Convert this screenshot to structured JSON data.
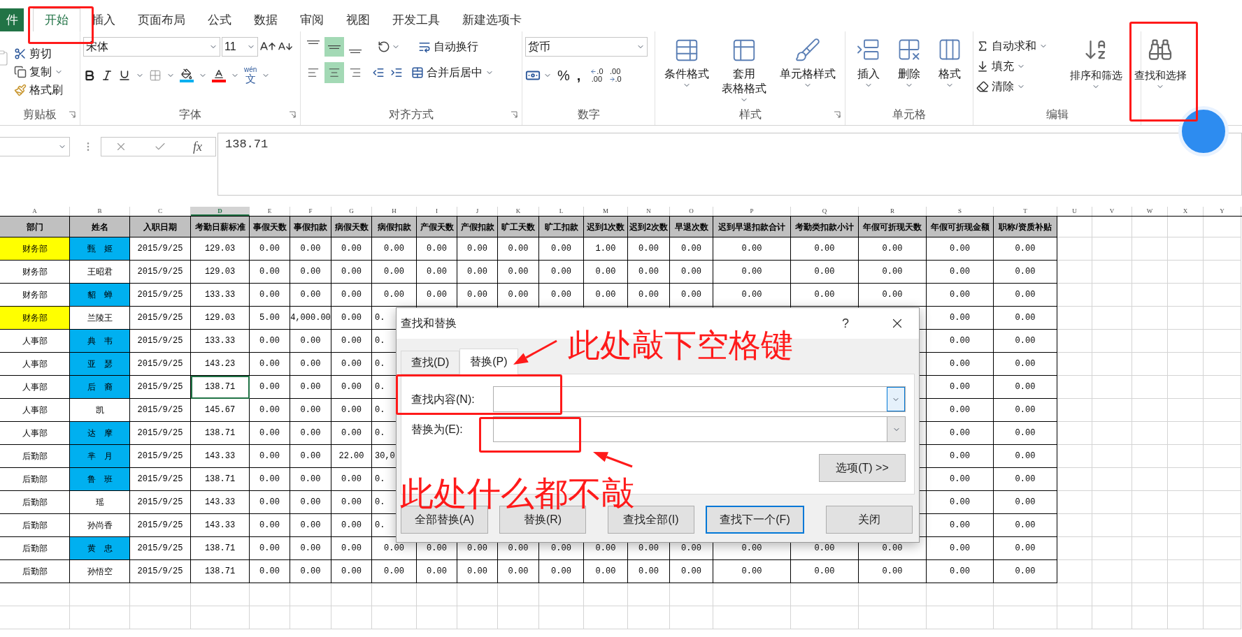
{
  "ribbon_tabs": [
    {
      "label": "件",
      "kind": "file",
      "selected": false
    },
    {
      "label": "开始",
      "kind": "tab",
      "selected": true
    },
    {
      "label": "插入",
      "kind": "tab",
      "selected": false
    },
    {
      "label": "页面布局",
      "kind": "tab",
      "selected": false
    },
    {
      "label": "公式",
      "kind": "tab",
      "selected": false
    },
    {
      "label": "数据",
      "kind": "tab",
      "selected": false
    },
    {
      "label": "审阅",
      "kind": "tab",
      "selected": false
    },
    {
      "label": "视图",
      "kind": "tab",
      "selected": false
    },
    {
      "label": "开发工具",
      "kind": "tab",
      "selected": false
    },
    {
      "label": "新建选项卡",
      "kind": "tab",
      "selected": false
    }
  ],
  "ribbon": {
    "clipboard": {
      "label": "剪贴板",
      "cut": "剪切",
      "copy": "复制",
      "painter": "格式刷"
    },
    "font": {
      "label": "字体",
      "font_name": "宋体",
      "font_size": "11",
      "phonetic_top": "wén",
      "phonetic_bottom": "文"
    },
    "alignment": {
      "label": "对齐方式",
      "vertical": [
        {
          "selected": false
        },
        {
          "selected": true
        },
        {
          "selected": false
        }
      ],
      "horizontal": [
        {
          "selected": false
        },
        {
          "selected": true
        },
        {
          "selected": false
        }
      ],
      "wrap": "自动换行",
      "merge": "合并后居中"
    },
    "number": {
      "label": "数字",
      "format": "货币",
      "percent": "%",
      "comma": ",",
      "increase_decimal": [
        ".0",
        ".00"
      ],
      "decrease_decimal": [
        ".00",
        ".0"
      ]
    },
    "styles": {
      "label": "样式",
      "buttons": [
        {
          "lines": [
            "条件格式"
          ]
        },
        {
          "lines": [
            "套用",
            "表格格式"
          ]
        },
        {
          "lines": [
            "单元格样式"
          ]
        }
      ]
    },
    "cells": {
      "label": "单元格",
      "buttons": [
        "插入",
        "删除",
        "格式"
      ]
    },
    "editing": {
      "label": "编辑",
      "small": [
        "自动求和",
        "填充",
        "清除"
      ],
      "large": [
        "排序和筛选",
        "查找和选择"
      ]
    }
  },
  "formula_bar": {
    "fx": "fx",
    "value": "138.71"
  },
  "table": {
    "column_letters": [
      {
        "label": "A",
        "selected": false
      },
      {
        "label": "B",
        "selected": false
      },
      {
        "label": "C",
        "selected": false
      },
      {
        "label": "D",
        "selected": true
      },
      {
        "label": "E",
        "selected": false
      },
      {
        "label": "F",
        "selected": false
      },
      {
        "label": "G",
        "selected": false
      },
      {
        "label": "H",
        "selected": false
      },
      {
        "label": "I",
        "selected": false
      },
      {
        "label": "J",
        "selected": false
      },
      {
        "label": "K",
        "selected": false
      },
      {
        "label": "L",
        "selected": false
      },
      {
        "label": "M",
        "selected": false
      },
      {
        "label": "N",
        "selected": false
      },
      {
        "label": "O",
        "selected": false
      },
      {
        "label": "P",
        "selected": false
      },
      {
        "label": "Q",
        "selected": false
      },
      {
        "label": "R",
        "selected": false
      },
      {
        "label": "S",
        "selected": false
      },
      {
        "label": "T",
        "selected": false
      },
      {
        "label": "U",
        "selected": false
      },
      {
        "label": "V",
        "selected": false
      },
      {
        "label": "W",
        "selected": false
      },
      {
        "label": "X",
        "selected": false
      },
      {
        "label": "Y",
        "selected": false
      }
    ],
    "headers": [
      "部门",
      "姓名",
      "入职日期",
      "考勤日薪标准",
      "事假天数",
      "事假扣款",
      "病假天数",
      "病假扣款",
      "产假天数",
      "产假扣款",
      "旷工天数",
      "旷工扣款",
      "迟到1次数",
      "迟到2次数",
      "早退次数",
      "迟到早退扣款合计",
      "考勤类扣款小计",
      "年假可折现天数",
      "年假可折现金额",
      "职称/资质补贴"
    ],
    "rows": [
      {
        "cells": [
          {
            "text": "财务部",
            "color": "#ffff00"
          },
          {
            "text": "甄　姬",
            "color": "#00b0f0"
          },
          "2015/9/25",
          "129.03",
          "0.00",
          "0.00",
          "0.00",
          "0.00",
          "0.00",
          "0.00",
          "0.00",
          "0.00",
          "1.00",
          "0.00",
          "0.00",
          "0.00",
          "0.00",
          "0.00",
          "0.00",
          "0.00"
        ],
        "active": false,
        "covered": false
      },
      {
        "cells": [
          "财务部",
          "王昭君",
          "2015/9/25",
          "129.03",
          "0.00",
          "0.00",
          "0.00",
          "0.00",
          "0.00",
          "0.00",
          "0.00",
          "0.00",
          "0.00",
          "0.00",
          "0.00",
          "0.00",
          "0.00",
          "0.00",
          "0.00",
          "0.00"
        ],
        "active": false,
        "covered": false
      },
      {
        "cells": [
          "财务部",
          {
            "text": "貂　蝉",
            "color": "#00b0f0"
          },
          "2015/9/25",
          "133.33",
          "0.00",
          "0.00",
          "0.00",
          "0.00",
          "0.00",
          "0.00",
          "0.00",
          "0.00",
          "0.00",
          "0.00",
          "0.00",
          "0.00",
          "0.00",
          "0.00",
          "0.00",
          "0.00"
        ],
        "active": false,
        "covered": false
      },
      {
        "cells": [
          {
            "text": "财务部",
            "color": "#ffff00"
          },
          "兰陵王",
          "2015/9/25",
          "129.03",
          "5.00",
          "4,000.00",
          "0.00",
          "0.",
          null,
          null,
          null,
          null,
          null,
          null,
          null,
          null,
          null,
          null,
          "0.00",
          "0.00"
        ],
        "active": false,
        "covered": true
      },
      {
        "cells": [
          "人事部",
          {
            "text": "典　韦",
            "color": "#00b0f0"
          },
          "2015/9/25",
          "133.33",
          "0.00",
          "0.00",
          "0.00",
          "0.",
          null,
          null,
          null,
          null,
          null,
          null,
          null,
          null,
          null,
          null,
          "0.00",
          "0.00"
        ],
        "active": false,
        "covered": true
      },
      {
        "cells": [
          "人事部",
          {
            "text": "亚　瑟",
            "color": "#00b0f0"
          },
          "2015/9/25",
          "143.23",
          "0.00",
          "0.00",
          "0.00",
          "0.",
          null,
          null,
          null,
          null,
          null,
          null,
          null,
          null,
          null,
          null,
          "0.00",
          "0.00"
        ],
        "active": false,
        "covered": true
      },
      {
        "cells": [
          "人事部",
          {
            "text": "后　裔",
            "color": "#00b0f0"
          },
          "2015/9/25",
          "138.71",
          "0.00",
          "0.00",
          "0.00",
          "0.",
          null,
          null,
          null,
          null,
          null,
          null,
          null,
          null,
          null,
          null,
          "0.00",
          "0.00"
        ],
        "active": true,
        "covered": true
      },
      {
        "cells": [
          "人事部",
          "凯",
          "2015/9/25",
          "145.67",
          "0.00",
          "0.00",
          "0.00",
          "0.",
          null,
          null,
          null,
          null,
          null,
          null,
          null,
          null,
          null,
          null,
          "0.00",
          "0.00"
        ],
        "active": false,
        "covered": true
      },
      {
        "cells": [
          "人事部",
          {
            "text": "达　摩",
            "color": "#00b0f0"
          },
          "2015/9/25",
          "138.71",
          "0.00",
          "0.00",
          "0.00",
          "0.",
          null,
          null,
          null,
          null,
          null,
          null,
          null,
          null,
          null,
          null,
          "0.00",
          "0.00"
        ],
        "active": false,
        "covered": true
      },
      {
        "cells": [
          "后勤部",
          {
            "text": "芈　月",
            "color": "#00b0f0"
          },
          "2015/9/25",
          "143.33",
          "0.00",
          "0.00",
          "22.00",
          "30,0",
          null,
          null,
          null,
          null,
          null,
          null,
          null,
          null,
          null,
          null,
          "0.00",
          "0.00"
        ],
        "active": false,
        "covered": true
      },
      {
        "cells": [
          "后勤部",
          {
            "text": "鲁　班",
            "color": "#00b0f0"
          },
          "2015/9/25",
          "138.71",
          "0.00",
          "0.00",
          "0.00",
          "0.",
          null,
          null,
          null,
          null,
          null,
          null,
          null,
          null,
          null,
          null,
          "0.00",
          "0.00"
        ],
        "active": false,
        "covered": true
      },
      {
        "cells": [
          "后勤部",
          "瑶",
          "2015/9/25",
          "143.33",
          "0.00",
          "0.00",
          "0.00",
          "0.",
          null,
          null,
          null,
          null,
          null,
          null,
          null,
          null,
          null,
          null,
          "0.00",
          "0.00"
        ],
        "active": false,
        "covered": true
      },
      {
        "cells": [
          "后勤部",
          "孙尚香",
          "2015/9/25",
          "143.33",
          "0.00",
          "0.00",
          "0.00",
          "0.",
          null,
          null,
          null,
          null,
          null,
          null,
          null,
          null,
          null,
          null,
          "0.00",
          "0.00"
        ],
        "active": false,
        "covered": true
      },
      {
        "cells": [
          "后勤部",
          {
            "text": "黄　忠",
            "color": "#00b0f0"
          },
          "2015/9/25",
          "138.71",
          "0.00",
          "0.00",
          "0.00",
          "0.00",
          "0.00",
          "0.00",
          "0.00",
          "0.00",
          "0.00",
          "0.00",
          "0.00",
          "0.00",
          "0.00",
          "0.00",
          "0.00",
          "0.00"
        ],
        "active": false,
        "covered": false
      },
      {
        "cells": [
          "后勤部",
          "孙悟空",
          "2015/9/25",
          "138.71",
          "0.00",
          "0.00",
          "0.00",
          "0.00",
          "0.00",
          "0.00",
          "0.00",
          "0.00",
          "0.00",
          "0.00",
          "0.00",
          "0.00",
          "0.00",
          "0.00",
          "0.00",
          "0.00"
        ],
        "active": false,
        "covered": false
      }
    ]
  },
  "dialog": {
    "title": "查找和替换",
    "help": "?",
    "tabs": [
      {
        "label": "查找(D)",
        "selected": false
      },
      {
        "label": "替换(P)",
        "selected": true
      }
    ],
    "fields": [
      {
        "label": "查找内容(N):",
        "focused": true
      },
      {
        "label": "替换为(E):",
        "focused": false
      }
    ],
    "options_button": "选项(T) >>",
    "buttons": [
      {
        "label": "全部替换(A)",
        "default": false
      },
      {
        "label": "替换(R)",
        "default": false
      },
      {
        "label": "查找全部(I)",
        "default": false
      },
      {
        "label": "查找下一个(F)",
        "default": true
      },
      {
        "label": "关闭",
        "default": false
      }
    ]
  },
  "annotations": [
    {
      "text": "此处敲下空格键"
    },
    {
      "text": "此处什么都不敲"
    }
  ]
}
